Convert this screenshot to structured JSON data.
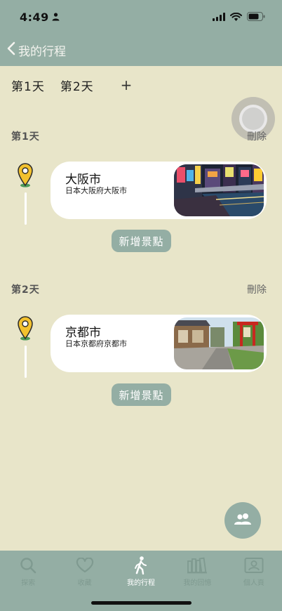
{
  "status": {
    "time": "4:49"
  },
  "nav": {
    "title": "我的行程"
  },
  "day_tabs": [
    "第1天",
    "第2天"
  ],
  "add_day_label": "+",
  "days": [
    {
      "title": "第1天",
      "delete_label": "刪除",
      "spot": {
        "name": "大阪市",
        "address": "日本大阪府大阪市"
      },
      "add_spot_label": "新增景點"
    },
    {
      "title": "第2天",
      "delete_label": "刪除",
      "spot": {
        "name": "京都市",
        "address": "日本京都府京都市"
      },
      "add_spot_label": "新增景點"
    }
  ],
  "tab_bar": {
    "items": [
      {
        "label": "探索",
        "icon": "search-icon"
      },
      {
        "label": "收藏",
        "icon": "heart-icon"
      },
      {
        "label": "我的行程",
        "icon": "walking-icon"
      },
      {
        "label": "我的回憶",
        "icon": "books-icon"
      },
      {
        "label": "個人頁",
        "icon": "profile-icon"
      }
    ],
    "active": 2
  },
  "colors": {
    "primary": "#94aea4",
    "background": "#e8e5c9",
    "card": "#ffffff",
    "tab_inactive": "#7f9a90"
  }
}
